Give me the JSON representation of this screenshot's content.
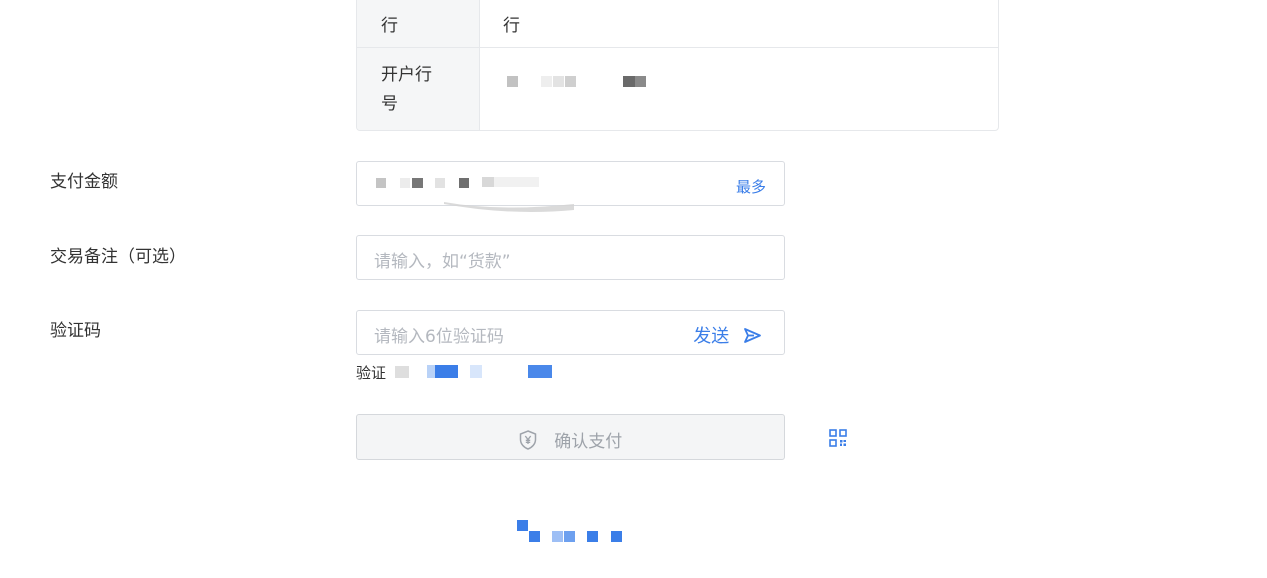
{
  "bank_info": {
    "row1_key": "行",
    "row1_value": "行",
    "row2_key": "开户行号"
  },
  "form": {
    "amount_label": "支付金额",
    "amount_max_label": "最多",
    "memo_label": "交易备注（可选）",
    "memo_placeholder": "请输入，如“货款”",
    "code_label": "验证码",
    "code_placeholder": "请输入6位验证码",
    "send_label": "发送",
    "phone_hint_prefix": "验证"
  },
  "pay_button": {
    "label": "确认支付",
    "icon": "shield-yen-icon"
  },
  "icons": {
    "send": "send-arrow-icon",
    "qr": "qr-code-icon"
  },
  "colors": {
    "accent": "#3b7ee8",
    "disabled_text": "#9ea3aa",
    "border": "#d9dce1"
  }
}
